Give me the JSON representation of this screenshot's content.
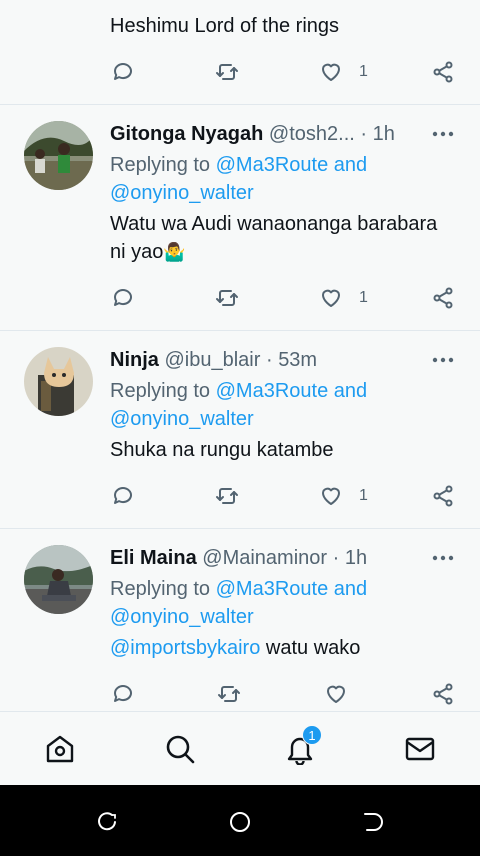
{
  "tweets": [
    {
      "text": "Heshimu Lord of the rings",
      "likes": "1"
    },
    {
      "name": "Gitonga Nyagah",
      "handle": "@tosh2...",
      "time": "1h",
      "replying_prefix": "Replying to",
      "replying_to_line1": "@Ma3Route and",
      "replying_to_line2": "@onyino_walter",
      "text_line1": "Watu wa Audi wanaonanga barabara",
      "text_line2": "ni yao",
      "emoji": "🤷‍♂️",
      "likes": "1"
    },
    {
      "name": "Ninja",
      "handle": "@ibu_blair",
      "time": "53m",
      "replying_prefix": "Replying to",
      "replying_to_line1": "@Ma3Route and",
      "replying_to_line2": "@onyino_walter",
      "text_line1": "Shuka na rungu katambe",
      "likes": "1"
    },
    {
      "name": "Eli Maina",
      "handle": "@Mainaminor",
      "time": "1h",
      "replying_prefix": "Replying to",
      "replying_to_line1": "@Ma3Route and",
      "replying_to_line2": "@onyino_walter",
      "mention": "@importsbykairo",
      "text_line1": "watu wako"
    }
  ],
  "separator": "·",
  "notifications_badge": "1",
  "colors": {
    "link": "#1d9bf0",
    "secondary_text": "#536471",
    "badge": "#1d9bf0"
  }
}
